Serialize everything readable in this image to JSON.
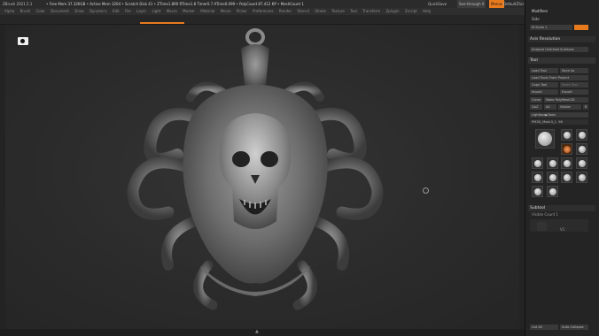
{
  "titlebar": {
    "app": "ZBrush 2021.5.1",
    "mem_info": "• Free Mem 37.326GB • Active Mem 3204 • Scratch Disk 41 • ZTime1.890 RTime1.8 Timer0.7 ATime0.099 • PolyCount 87.412 KP • MeshCount 1",
    "quicksave": "QuickSave",
    "seethrough": "See-through",
    "seethrough_value": "0",
    "menus_btn": "Menus",
    "ui_name": "DefaultZScript"
  },
  "menubar": {
    "items": [
      "Alpha",
      "Brush",
      "Color",
      "Document",
      "Draw",
      "Dynamics",
      "Edit",
      "File",
      "Layer",
      "Light",
      "Macro",
      "Marker",
      "Material",
      "Movie",
      "Picker",
      "Preferences",
      "Render",
      "Stencil",
      "Stroke",
      "Texture",
      "Tool",
      "Transform",
      "Zplugin",
      "Zscript",
      "Help"
    ]
  },
  "tray": {
    "modifiers_title": "Modifiers",
    "side_label": "Side",
    "rgbspeed_label": "M Scale",
    "rgbspeed_value": "1",
    "axis_title": "Axis Resolution",
    "analyze_label": "Analyze Unlinked Surfaces",
    "tool_title": "Tool",
    "buttons": [
      [
        "Load Tool",
        "Save As"
      ],
      [
        "Load Tools From Project"
      ],
      [
        "Copy Tool",
        "Paste Tool"
      ],
      [
        "Import",
        "Export"
      ],
      [
        "Clone",
        "Make PolyMesh3D"
      ],
      [
        "GoZ",
        "All",
        "Visible",
        "R"
      ]
    ],
    "lightbox_label": "Lightbox▶Tools",
    "tool_value": "PM3D_Mesh3_1. 98",
    "subtool_title": "Subtool",
    "visible_count": "Visible Count 1",
    "subtool_value": "V1",
    "bottom_label": "List All",
    "bottom_label2": "Auto Collapse"
  },
  "viewport": {
    "description": ""
  }
}
